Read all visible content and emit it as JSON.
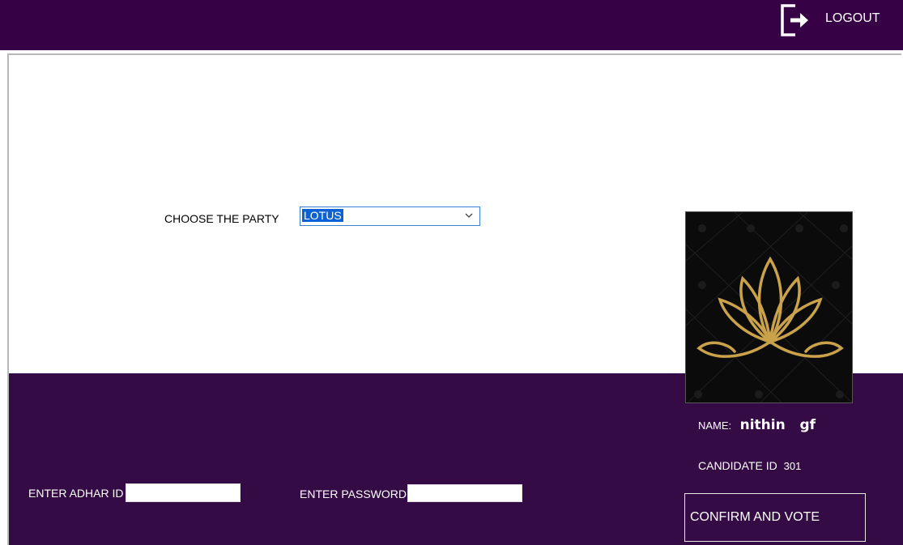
{
  "header": {
    "logout_label": "LOGOUT",
    "logout_icon": "logout-icon",
    "background_color": "#370245"
  },
  "vote_form": {
    "party_label": "CHOOSE THE PARTY",
    "party_selected": "LOTUS",
    "party_image_icon": "lotus-logo",
    "adhar_label": "ENTER ADHAR ID",
    "adhar_value": "",
    "password_label": "ENTER PASSWORD",
    "password_value": "",
    "confirm_label": "CONFIRM AND VOTE"
  },
  "candidate": {
    "name_label": "NAME:",
    "name_value": "nithin   gf",
    "id_label": "CANDIDATE ID",
    "id_value": "301"
  },
  "colors": {
    "bottom_band": "#340b44",
    "select_highlight": "#0a62d6",
    "lotus_gold": "#c9a24a"
  }
}
